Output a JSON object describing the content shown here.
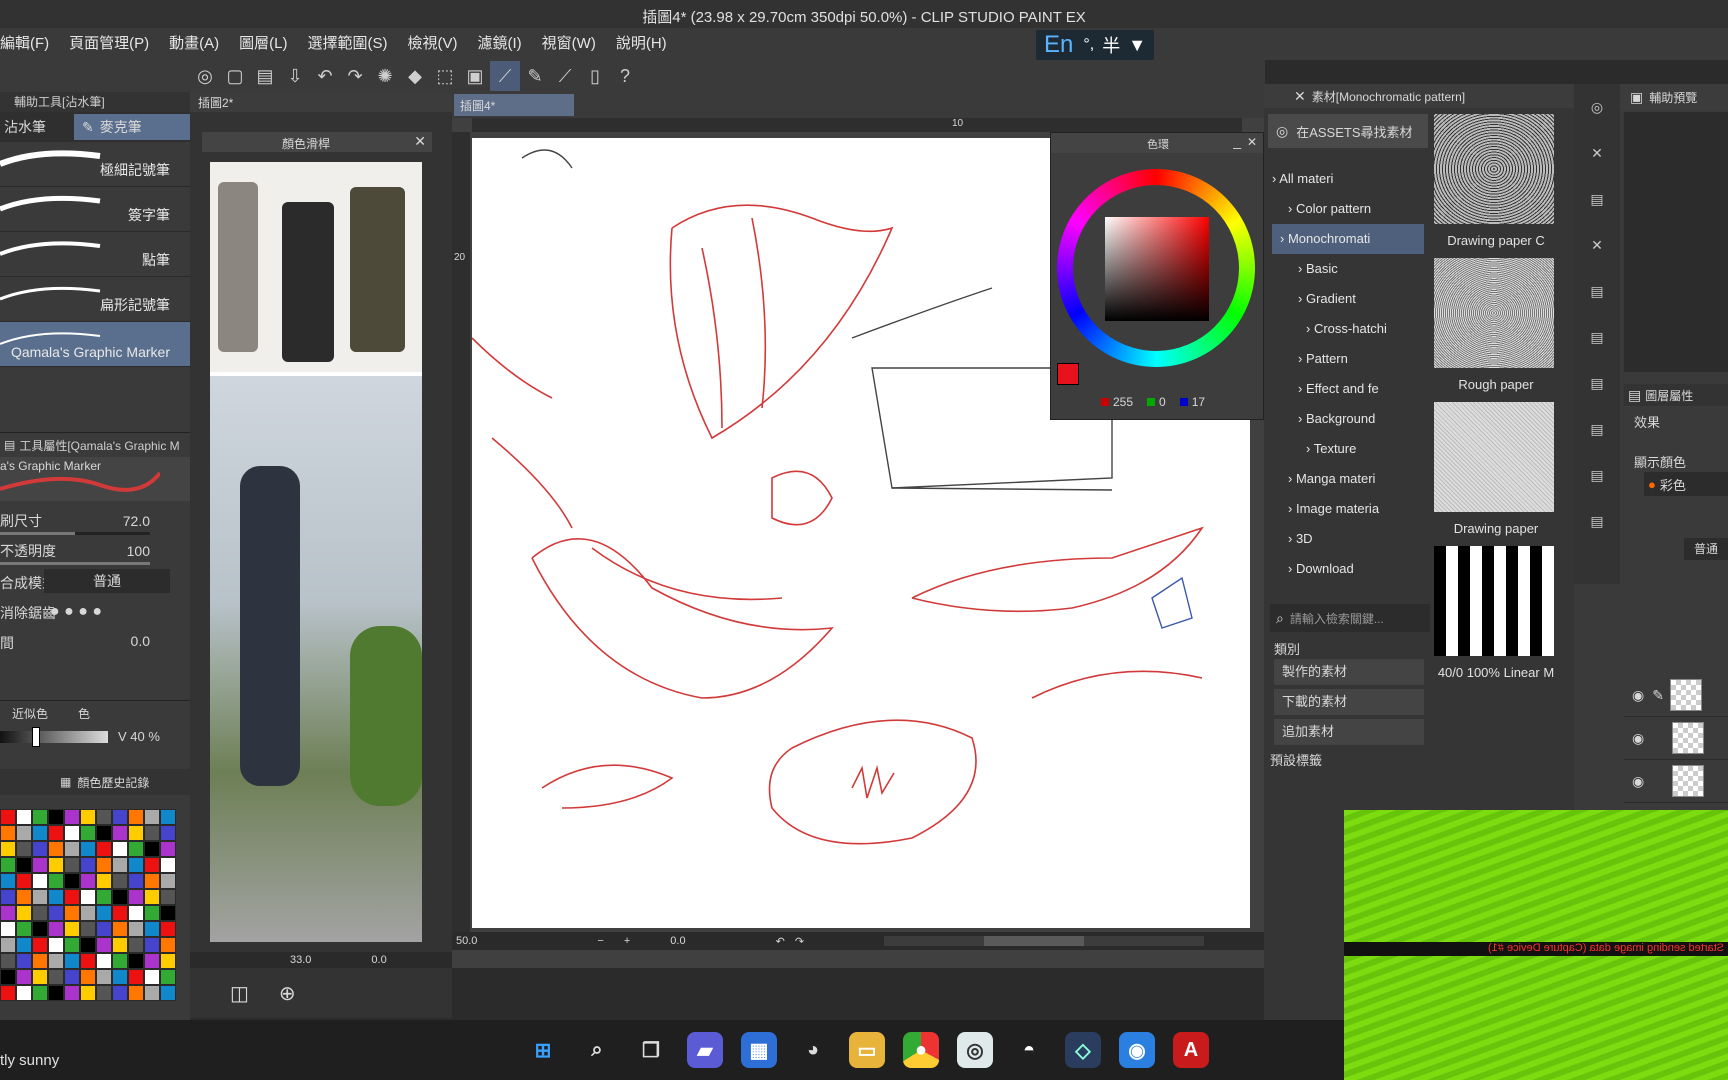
{
  "window": {
    "title": "插圖4* (23.98 x 29.70cm 350dpi 50.0%) - CLIP STUDIO PAINT EX"
  },
  "menu": [
    "編輯(F)",
    "頁面管理(P)",
    "動畫(A)",
    "圖層(L)",
    "選擇範圍(S)",
    "檢視(V)",
    "濾鏡(I)",
    "視窗(W)",
    "說明(H)"
  ],
  "ime": {
    "en": "En",
    "punct": "°,",
    "half": "半"
  },
  "subtool": {
    "header": "輔助工具[沾水筆]",
    "tab_a": "沾水筆",
    "tab_b": "麥克筆",
    "brushes": [
      "極細記號筆",
      "簽字筆",
      "點筆",
      "扁形記號筆",
      "Qamala's Graphic Marker"
    ]
  },
  "tool_props": {
    "header": "工具屬性[Qamala's Graphic M",
    "preview_name": "a's Graphic Marker",
    "size_label": "刷尺寸",
    "size_value": "72.0",
    "opacity_label": "不透明度",
    "opacity_value": "100",
    "blend_label": "合成模式",
    "blend_value": "普通",
    "aa_label": "消除鋸齒",
    "last_label": "間",
    "last_value": "0.0"
  },
  "color_set": {
    "tab_near": "近似色",
    "tab_b": "色",
    "v_label": "V 40 %",
    "history_tab": "顏色歷史記錄"
  },
  "reference": {
    "title": "顏色滑桿",
    "tab": "插圖2*"
  },
  "canvas": {
    "tab": "插圖4*",
    "ruler_10": "10",
    "ruler_20": "20",
    "zoom_left": "33.0",
    "zoom_bottom": "50.0",
    "angle_left": "0.0",
    "angle_bottom": "0.0"
  },
  "color_wheel": {
    "title": "色環",
    "r": "255",
    "g": "0",
    "b": "17"
  },
  "materials": {
    "header": "素材[Monochromatic pattern]",
    "assets_button": "在ASSETS尋找素材",
    "tree": [
      "All materi",
      "Color pattern",
      "Monochromati",
      "Basic",
      "Gradient",
      "Cross-hatchi",
      "Pattern",
      "Effect and fe",
      "Background",
      "Texture",
      "Manga materi",
      "Image materia",
      "3D",
      "Download"
    ],
    "thumbs": [
      "Drawing paper C",
      "Rough paper",
      "Drawing paper",
      "40/0 100% Linear M"
    ],
    "search_placeholder": "請輸入檢索關鍵...",
    "category_label": "類別",
    "cat_buttons": [
      "製作的素材",
      "下載的素材",
      "追加素材"
    ],
    "preset_label": "預設標籤"
  },
  "right_panel": {
    "header": "輔助預覽",
    "layer_props": "圖層屬性",
    "effect": "效果",
    "display_color": "顯示顏色",
    "color_mode": "彩色",
    "blend": "普通"
  },
  "capture_notice": "Started sending image data (Capture Device #1)",
  "weather": "tly sunny",
  "colors": {
    "accent": "#5a8fd6",
    "green": "#7ddc10",
    "red_stroke": "#d23a3a"
  }
}
